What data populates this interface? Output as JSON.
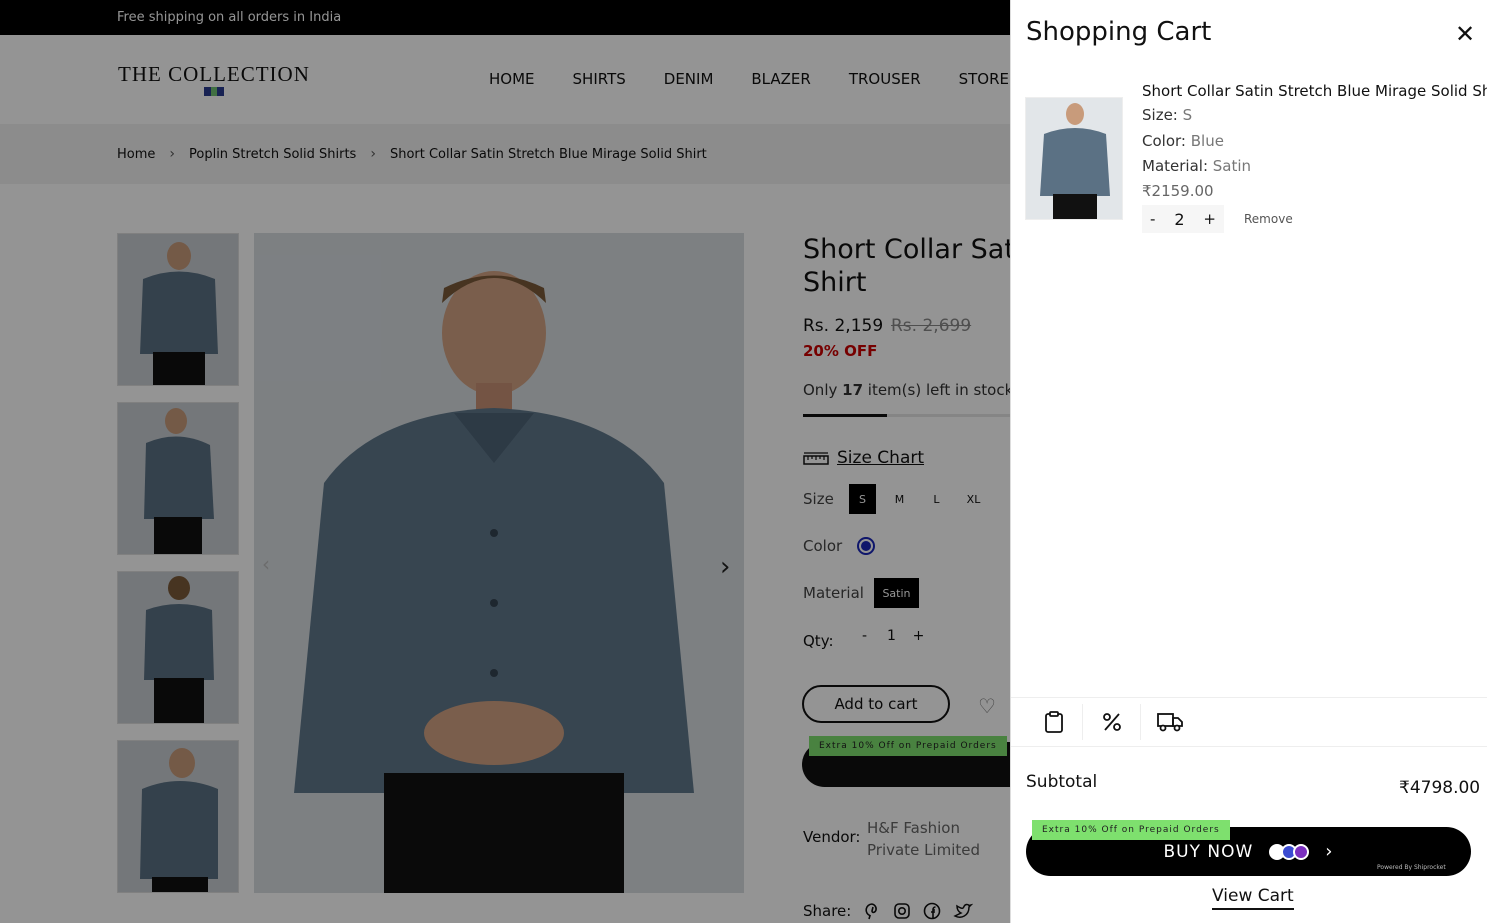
{
  "announcement": "Free shipping on all orders in India",
  "brand": {
    "name": "THE COLLECTION",
    "mark_colors": [
      "#2a3b8f",
      "#6fbf73",
      "#2a3b8f"
    ]
  },
  "nav": [
    "HOME",
    "SHIRTS",
    "DENIM",
    "BLAZER",
    "TROUSER",
    "STORE L"
  ],
  "breadcrumb": [
    "Home",
    "Poplin Stretch Solid Shirts",
    "Short Collar Satin Stretch Blue Mirage Solid Shirt"
  ],
  "product": {
    "title": "Short Collar Satin Shirt",
    "price": "Rs. 2,159",
    "compare_price": "Rs. 2,699",
    "discount": "20% OFF",
    "stock_prefix": "Only ",
    "stock_count": "17",
    "stock_suffix": " item(s) left in stock!",
    "stock_level": 0.4,
    "size_chart_label": "Size Chart",
    "size_label": "Size",
    "sizes": [
      "S",
      "M",
      "L",
      "XL"
    ],
    "selected_size": "S",
    "color_label": "Color",
    "color_value": "#1a27b8",
    "material_label": "Material",
    "material": "Satin",
    "qty_label": "Qty:",
    "qty_minus": "-",
    "qty_value": "1",
    "qty_plus": "+",
    "add_to_cart": "Add to cart",
    "promo": "Extra 10% Off on Prepaid Orders",
    "vendor_label": "Vendor:",
    "vendor": "H&F Fashion Private Limited",
    "share_label": "Share:"
  },
  "cart": {
    "title": "Shopping Cart",
    "item": {
      "name": "Short Collar Satin Stretch Blue Mirage Solid Shirt",
      "size_label": "Size:",
      "size": "S",
      "color_label": "Color:",
      "color": "Blue",
      "material_label": "Material:",
      "material": "Satin",
      "price": "₹2159.00",
      "qty_minus": "-",
      "qty": "2",
      "qty_plus": "+",
      "remove": "Remove"
    },
    "subtotal_label": "Subtotal",
    "subtotal": "₹4798.00",
    "promo": "Extra 10% Off on Prepaid Orders",
    "buy_now": "BUY NOW",
    "powered_by": "Powered By Shiprocket",
    "view_cart": "View Cart"
  }
}
